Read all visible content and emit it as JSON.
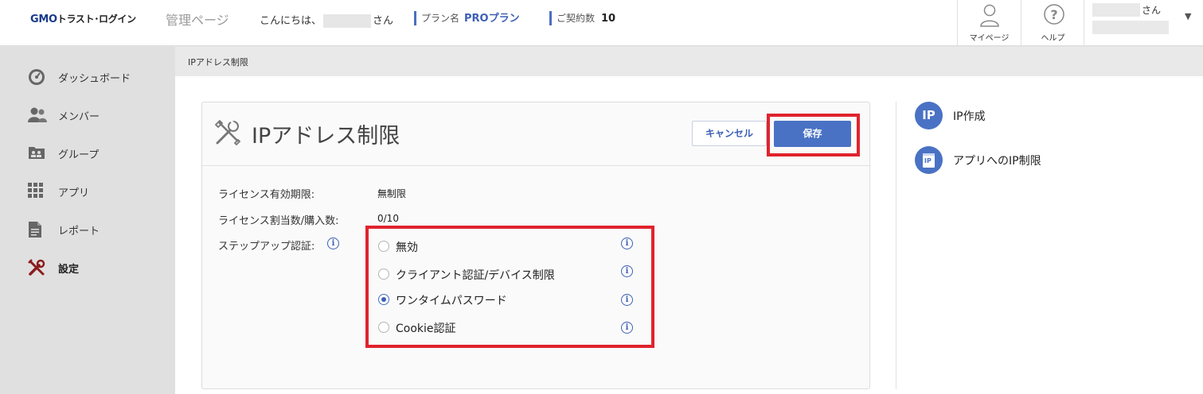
{
  "header": {
    "logo_brand": "GMO",
    "logo_rest": "トラスト･ログイン",
    "admin_page": "管理ページ",
    "greeting_prefix": "こんにちは、",
    "greeting_suffix": "さん",
    "plan_label": "プラン名",
    "plan_value": "PROプラン",
    "contracts_label": "ご契約数",
    "contracts_value": "10",
    "mypage_label": "マイページ",
    "help_label": "ヘルプ",
    "user_suffix": "さん",
    "user_caret": "▼"
  },
  "sidebar": {
    "items": [
      {
        "label": "ダッシュボード",
        "icon": "dashboard-icon"
      },
      {
        "label": "メンバー",
        "icon": "members-icon"
      },
      {
        "label": "グループ",
        "icon": "group-icon"
      },
      {
        "label": "アプリ",
        "icon": "apps-grid-icon"
      },
      {
        "label": "レポート",
        "icon": "report-icon"
      },
      {
        "label": "設定",
        "icon": "tools-icon",
        "active": true
      }
    ]
  },
  "breadcrumb": "IPアドレス制限",
  "card": {
    "title": "IPアドレス制限",
    "cancel_label": "キャンセル",
    "save_label": "保存",
    "rows": [
      {
        "label": "ライセンス有効期限:",
        "value": "無制限"
      },
      {
        "label": "ライセンス割当数/購入数:",
        "value": "0/10"
      }
    ],
    "stepup_label": "ステップアップ認証:",
    "options": [
      {
        "label": "無効",
        "checked": false
      },
      {
        "label": "クライアント認証/デバイス制限",
        "checked": false
      },
      {
        "label": "ワンタイムパスワード",
        "checked": true
      },
      {
        "label": "Cookie認証",
        "checked": false
      }
    ],
    "info_glyph": "i"
  },
  "right_panel": {
    "links": [
      {
        "label": "IP作成",
        "badge": "IP"
      },
      {
        "label": "アプリへのIP制限",
        "badge": "IP"
      }
    ]
  },
  "colors": {
    "accent": "#4a72c4",
    "highlight": "#e0232d",
    "sidebar_bg": "#e0e0e0"
  }
}
